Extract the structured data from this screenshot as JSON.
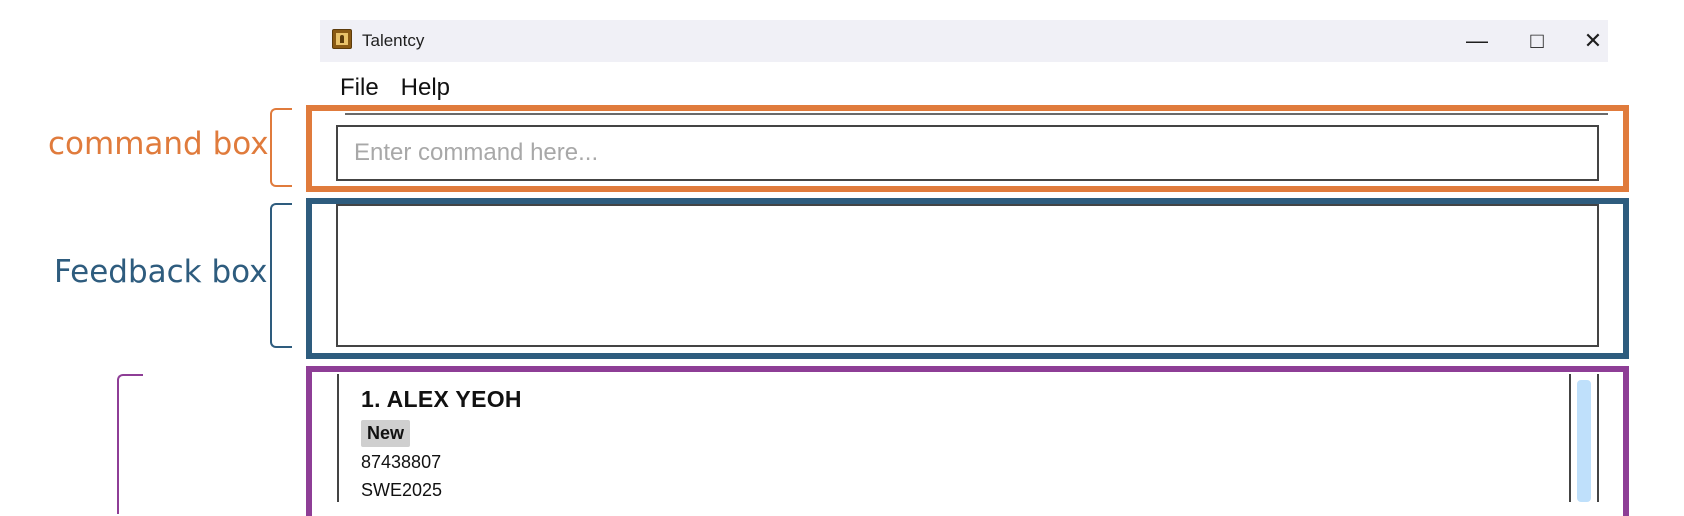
{
  "window": {
    "title": "Talentcy",
    "minimize_glyph": "—",
    "maximize_glyph": "□",
    "close_glyph": "✕"
  },
  "menu": {
    "items": [
      "File",
      "Help"
    ]
  },
  "command_box": {
    "placeholder": "Enter command here...",
    "value": ""
  },
  "feedback_box": {
    "text": ""
  },
  "person_list": {
    "items": [
      {
        "name": "1. ALEX YEOH",
        "tag": "New",
        "phone": "87438807",
        "job": "SWE2025"
      }
    ]
  },
  "annotations": {
    "command_box_label": "command box",
    "feedback_box_label": "Feedback box",
    "colors": {
      "command": "#e07b3c",
      "feedback": "#2e5c7e",
      "list": "#8e3e96"
    }
  },
  "icons": {
    "app": "app-icon",
    "minimize": "minimize-icon",
    "maximize": "maximize-icon",
    "close": "close-icon"
  }
}
